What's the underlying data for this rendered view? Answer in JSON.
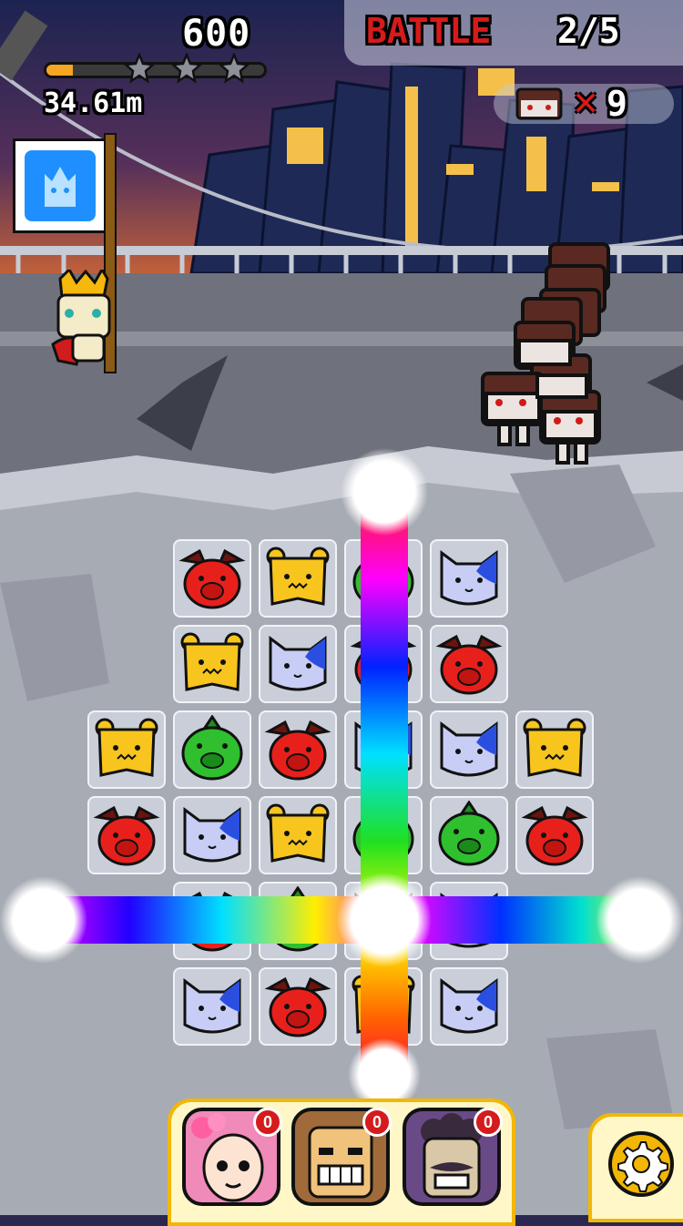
{
  "hud": {
    "score": "600",
    "distance": "34.61m",
    "progress_fraction": 0.12,
    "stars_earned": 0,
    "stars_total": 3
  },
  "battle": {
    "label": "BATTLE",
    "count": "2/5"
  },
  "enemies": {
    "remaining": "9",
    "icon": "zombie-head-icon"
  },
  "flag": {
    "icon": "castle-crown-icon"
  },
  "board": {
    "rows": [
      [
        null,
        "red-dog",
        "yellow-bear",
        "green-pig",
        "blue-cat",
        null
      ],
      [
        null,
        "yellow-bear",
        "blue-cat",
        "red-dog",
        "red-dog",
        null
      ],
      [
        "yellow-bear",
        "green-pig",
        "red-dog",
        "blue-cat",
        "blue-cat",
        "yellow-bear"
      ],
      [
        "red-dog",
        "blue-cat",
        "yellow-bear",
        "green-pig",
        "green-pig",
        "red-dog"
      ],
      [
        null,
        "red-dog",
        "green-pig",
        "blue-cat",
        "blue-cat",
        null
      ],
      [
        null,
        "blue-cat",
        "red-dog",
        "yellow-bear",
        "blue-cat",
        null
      ]
    ]
  },
  "characters": [
    {
      "name": "flower-girl-portrait",
      "count": "0"
    },
    {
      "name": "grinning-boy-portrait",
      "count": "0"
    },
    {
      "name": "mustache-man-portrait",
      "count": "0"
    }
  ],
  "settings": {
    "icon": "gear-icon"
  },
  "colors": {
    "red_piece": "#e8201c",
    "yellow_piece": "#f7c51e",
    "green_piece": "#2fbf2f",
    "blue_piece": "#c8cdf5",
    "accent": "#f2b705",
    "battle_red": "#d51b1b"
  }
}
